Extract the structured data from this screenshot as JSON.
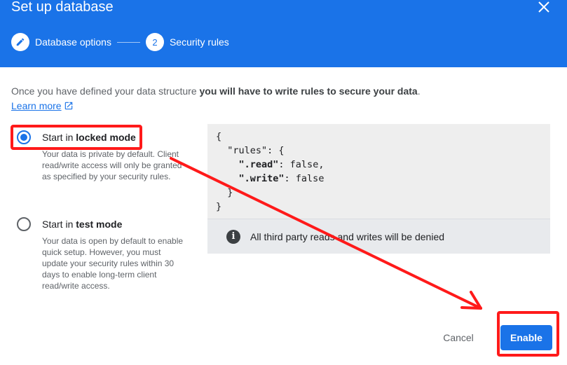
{
  "header": {
    "title": "Set up database",
    "steps": [
      {
        "marker": "",
        "label": "Database options",
        "state": "complete"
      },
      {
        "marker": "2",
        "label": "Security rules",
        "state": "active"
      }
    ]
  },
  "intro": {
    "text_plain": "Once you have defined your data structure ",
    "text_bold": "you will have to write rules to secure your data",
    "text_end": ".",
    "learn_more": "Learn more"
  },
  "options": [
    {
      "label_prefix": "Start in ",
      "label_bold": "locked mode",
      "checked": true,
      "description": "Your data is private by default. Client read/write access will only be granted as specified by your security rules."
    },
    {
      "label_prefix": "Start in ",
      "label_bold": "test mode",
      "checked": false,
      "description": "Your data is open by default to enable quick setup. However, you must update your security rules within 30 days to enable long-term client read/write access."
    }
  ],
  "code": {
    "line1": "{",
    "line2": "  \"rules\": {",
    "line3_key": "\".read\"",
    "line3_val": ": false,",
    "line4_key": "\".write\"",
    "line4_val": ": false",
    "line5": "  }",
    "line6": "}"
  },
  "info": {
    "icon": "i",
    "text": "All third party reads and writes will be denied"
  },
  "footer": {
    "cancel": "Cancel",
    "enable": "Enable"
  },
  "colors": {
    "primary": "#1a73e8",
    "annotation": "#ff1a1a"
  }
}
